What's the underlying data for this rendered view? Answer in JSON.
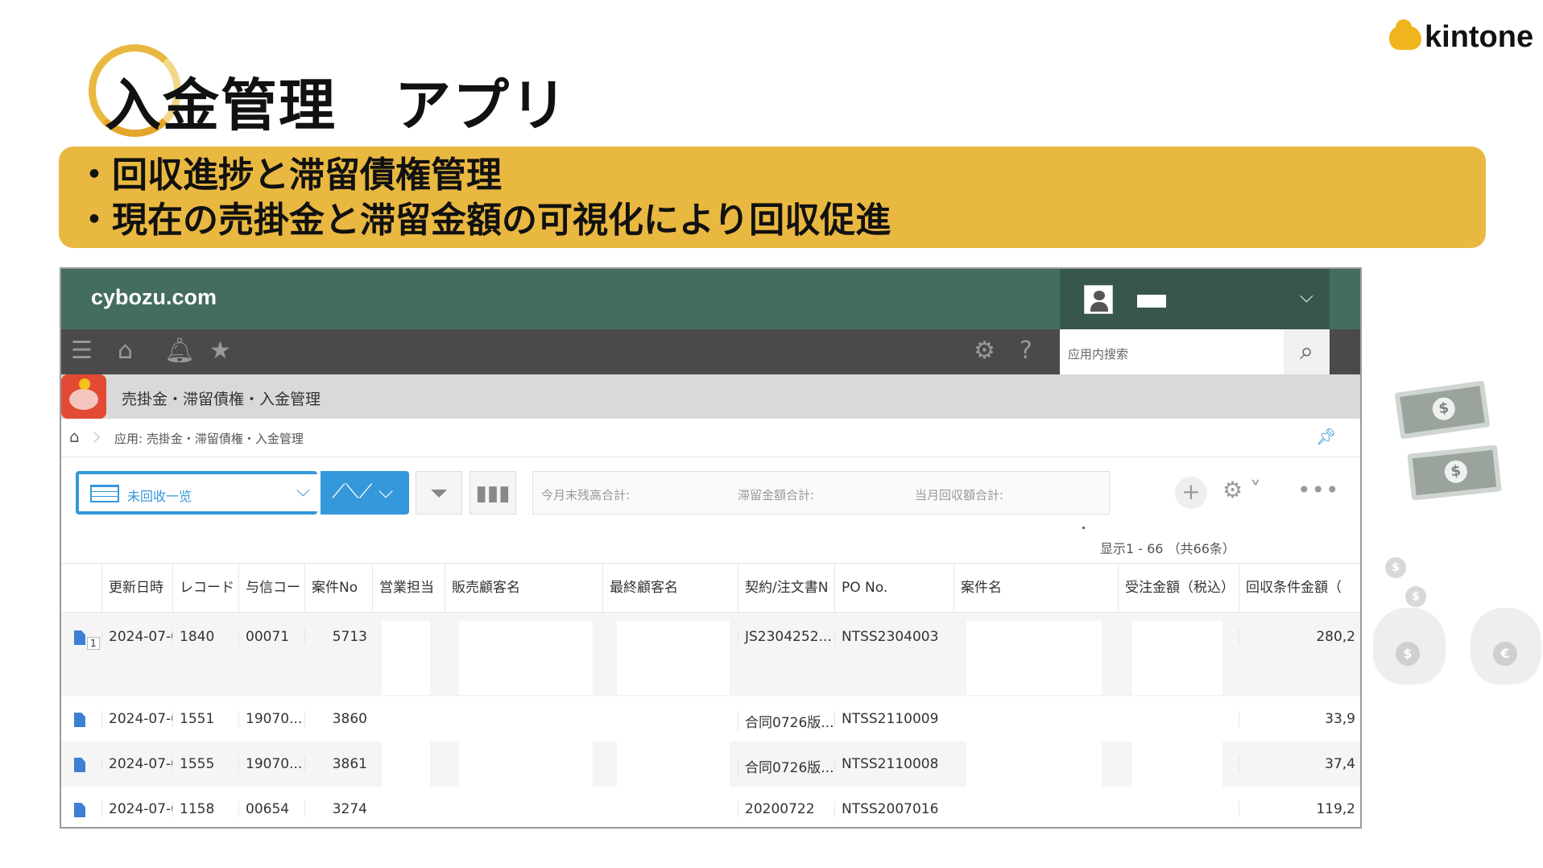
{
  "slide": {
    "title": "入金管理　アプリ",
    "logo_text": "kintone",
    "bullets": [
      "・回収進捗と滞留債権管理",
      "・現在の売掛金と滞留金額の可視化により回収促進"
    ]
  },
  "app": {
    "brand": "cybozu.com",
    "search_placeholder": "应用内搜索",
    "app_title": "売掛金・滞留債権・入金管理",
    "breadcrumb": "应用: 売掛金・滞留債権・入金管理",
    "view_label": "未回收一览",
    "totals": [
      "今月末残高合計:",
      "滞留金額合計:",
      "当月回収額合計:"
    ],
    "record_count": "显示1 - 66 （共66条）",
    "columns": [
      "更新日時",
      "レコード",
      "与信コー",
      "案件No",
      "営業担当",
      "販売顧客名",
      "最終顧客名",
      "契約/注文書N",
      "PO No.",
      "案件名",
      "受注金額（税込）",
      "回収条件金額（"
    ],
    "rows": [
      {
        "badge": "1",
        "date": "2024-07-0",
        "record": "1840",
        "credit": "00071",
        "case_no": "5713",
        "contract": "JS2304252...",
        "po": "NTSS2304003",
        "amount": "280,2"
      },
      {
        "badge": "",
        "date": "2024-07-0",
        "record": "1551",
        "credit": "19070...",
        "case_no": "3860",
        "contract": "合同0726版...",
        "po": "NTSS2110009",
        "amount": "33,9"
      },
      {
        "badge": "",
        "date": "2024-07-0",
        "record": "1555",
        "credit": "19070...",
        "case_no": "3861",
        "contract": "合同0726版...",
        "po": "NTSS2110008",
        "amount": "37,4"
      },
      {
        "badge": "",
        "date": "2024-07-0",
        "record": "1158",
        "credit": "00654",
        "case_no": "3274",
        "contract": "20200722",
        "po": "NTSS2007016",
        "amount": "119,2"
      }
    ]
  },
  "icons": {
    "menu": "menu-icon",
    "home": "home-icon",
    "bell": "bell-icon",
    "star": "star-icon",
    "gear": "gear-icon",
    "help": "help-icon",
    "search": "search-icon"
  },
  "colors": {
    "accent_yellow": "#e9b840",
    "header_green": "#446d5e",
    "nav_dark": "#4a4a4a",
    "kintone_blue": "#3498db"
  }
}
